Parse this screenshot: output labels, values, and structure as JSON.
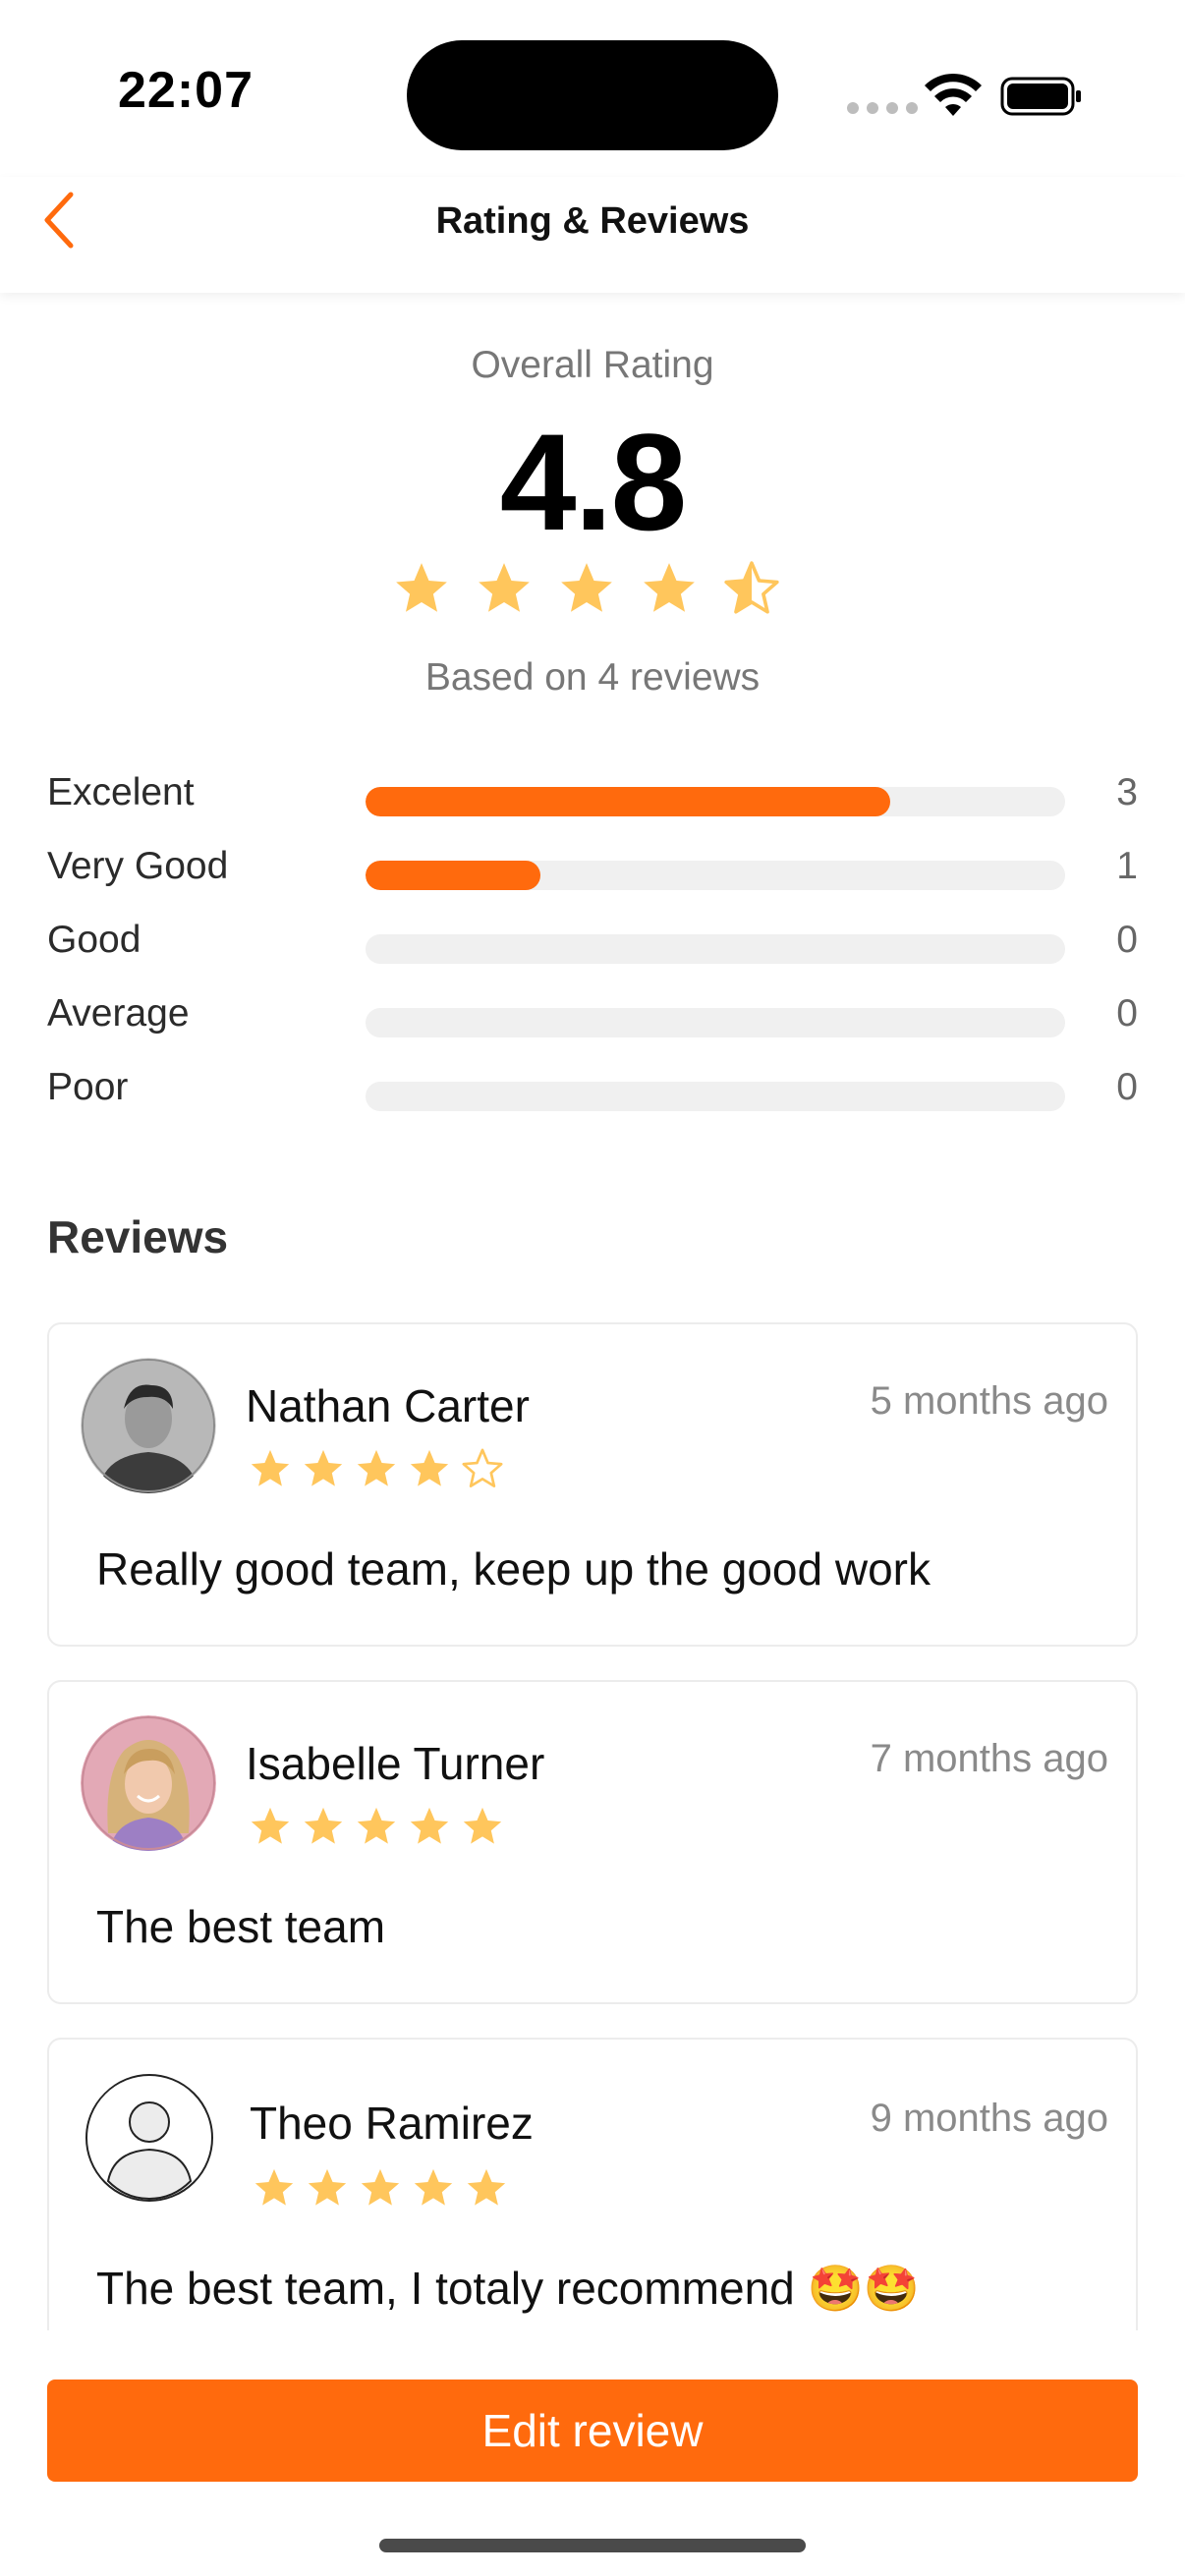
{
  "status_bar": {
    "time": "22:07"
  },
  "header": {
    "title": "Rating & Reviews"
  },
  "overall": {
    "label": "Overall Rating",
    "value": "4.8",
    "rating": 4.8,
    "based_on": "Based on 4 reviews"
  },
  "distribution": [
    {
      "label": "Excelent",
      "count": "3",
      "fill": 0.75
    },
    {
      "label": "Very Good",
      "count": "1",
      "fill": 0.25
    },
    {
      "label": "Good",
      "count": "0",
      "fill": 0
    },
    {
      "label": "Average",
      "count": "0",
      "fill": 0
    },
    {
      "label": "Poor",
      "count": "0",
      "fill": 0
    }
  ],
  "reviews_title": "Reviews",
  "reviews": [
    {
      "name": "Nathan Carter",
      "date": "5 months ago",
      "stars": 4,
      "text": "Really good team, keep up the good work",
      "avatar": "photo-man-icon"
    },
    {
      "name": "Isabelle Turner",
      "date": "7 months ago",
      "stars": 5,
      "text": "The best team",
      "avatar": "photo-woman-icon"
    },
    {
      "name": "Theo Ramirez",
      "date": "9 months ago",
      "stars": 5,
      "text": "The best team, I totaly recommend 🤩🤩",
      "avatar": "default-user-icon"
    }
  ],
  "edit_button": {
    "label": "Edit review"
  },
  "colors": {
    "accent": "#ff6a0d",
    "star": "#ffc65c",
    "track": "#f0f0f0"
  }
}
